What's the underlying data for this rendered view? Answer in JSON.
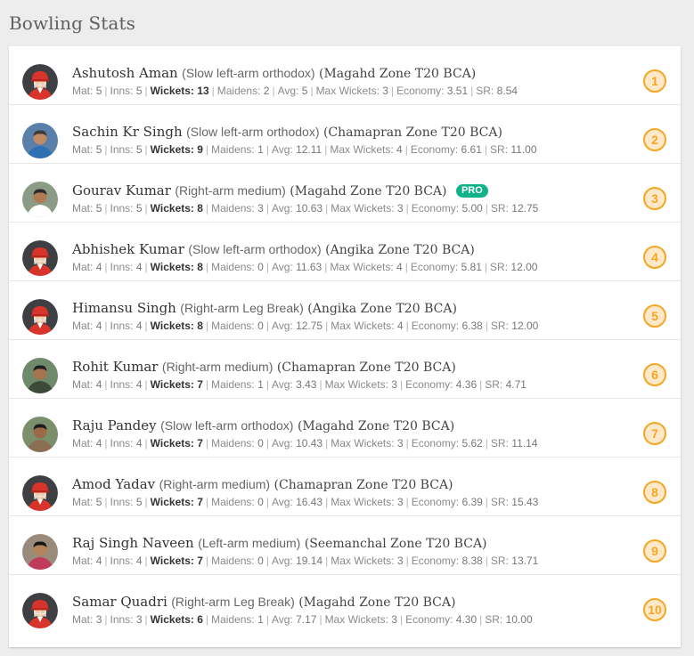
{
  "page": {
    "title": "Bowling Stats"
  },
  "labels": {
    "mat": "Mat:",
    "inns": "Inns:",
    "wickets": "Wickets:",
    "maidens": "Maidens:",
    "avg": "Avg:",
    "max_wickets": "Max Wickets:",
    "economy": "Economy:",
    "sr": "SR:"
  },
  "colors": {
    "accent": "#f5a623",
    "pro": "#10b28a"
  },
  "bowlers": [
    {
      "name": "Ashutosh Aman",
      "style": "(Slow left-arm orthodox)",
      "team": "(Magahd Zone T20 BCA)",
      "pro": "",
      "mat": "5",
      "inns": "5",
      "wickets": "13",
      "maidens": "2",
      "avg": "5",
      "max_wickets": "3",
      "economy": "3.51",
      "sr": "8.54",
      "rank": "1",
      "avatar": "default-cricketer"
    },
    {
      "name": "Sachin Kr Singh",
      "style": "(Slow left-arm orthodox)",
      "team": "(Chamapran Zone T20 BCA)",
      "pro": "",
      "mat": "5",
      "inns": "5",
      "wickets": "9",
      "maidens": "1",
      "avg": "12.11",
      "max_wickets": "4",
      "economy": "6.61",
      "sr": "11.00",
      "rank": "2",
      "avatar": "photo"
    },
    {
      "name": "Gourav Kumar",
      "style": "(Right-arm medium)",
      "team": "(Magahd Zone T20 BCA)",
      "pro": "PRO",
      "mat": "5",
      "inns": "5",
      "wickets": "8",
      "maidens": "3",
      "avg": "10.63",
      "max_wickets": "3",
      "economy": "5.00",
      "sr": "12.75",
      "rank": "3",
      "avatar": "photo"
    },
    {
      "name": "Abhishek Kumar",
      "style": "(Slow left-arm orthodox)",
      "team": "(Angika Zone T20 BCA)",
      "pro": "",
      "mat": "4",
      "inns": "4",
      "wickets": "8",
      "maidens": "0",
      "avg": "11.63",
      "max_wickets": "4",
      "economy": "5.81",
      "sr": "12.00",
      "rank": "4",
      "avatar": "default-cricketer"
    },
    {
      "name": "Himansu Singh",
      "style": "(Right-arm Leg Break)",
      "team": "(Angika Zone T20 BCA)",
      "pro": "",
      "mat": "4",
      "inns": "4",
      "wickets": "8",
      "maidens": "0",
      "avg": "12.75",
      "max_wickets": "4",
      "economy": "6.38",
      "sr": "12.00",
      "rank": "5",
      "avatar": "default-cricketer"
    },
    {
      "name": "Rohit Kumar",
      "style": "(Right-arm medium)",
      "team": "(Chamapran Zone T20 BCA)",
      "pro": "",
      "mat": "4",
      "inns": "4",
      "wickets": "7",
      "maidens": "1",
      "avg": "3.43",
      "max_wickets": "3",
      "economy": "4.36",
      "sr": "4.71",
      "rank": "6",
      "avatar": "photo"
    },
    {
      "name": "Raju Pandey",
      "style": "(Slow left-arm orthodox)",
      "team": "(Magahd Zone T20 BCA)",
      "pro": "",
      "mat": "4",
      "inns": "4",
      "wickets": "7",
      "maidens": "0",
      "avg": "10.43",
      "max_wickets": "3",
      "economy": "5.62",
      "sr": "11.14",
      "rank": "7",
      "avatar": "photo"
    },
    {
      "name": "Amod Yadav",
      "style": "(Right-arm medium)",
      "team": "(Chamapran Zone T20 BCA)",
      "pro": "",
      "mat": "5",
      "inns": "5",
      "wickets": "7",
      "maidens": "0",
      "avg": "16.43",
      "max_wickets": "3",
      "economy": "6.39",
      "sr": "15.43",
      "rank": "8",
      "avatar": "default-cricketer"
    },
    {
      "name": "Raj Singh Naveen",
      "style": "(Left-arm medium)",
      "team": "(Seemanchal Zone T20 BCA)",
      "pro": "",
      "mat": "4",
      "inns": "4",
      "wickets": "7",
      "maidens": "0",
      "avg": "19.14",
      "max_wickets": "3",
      "economy": "8.38",
      "sr": "13.71",
      "rank": "9",
      "avatar": "photo"
    },
    {
      "name": "Samar Quadri",
      "style": "(Right-arm Leg Break)",
      "team": "(Magahd Zone T20 BCA)",
      "pro": "",
      "mat": "3",
      "inns": "3",
      "wickets": "6",
      "maidens": "1",
      "avg": "7.17",
      "max_wickets": "3",
      "economy": "4.30",
      "sr": "10.00",
      "rank": "10",
      "avatar": "default-cricketer"
    }
  ]
}
